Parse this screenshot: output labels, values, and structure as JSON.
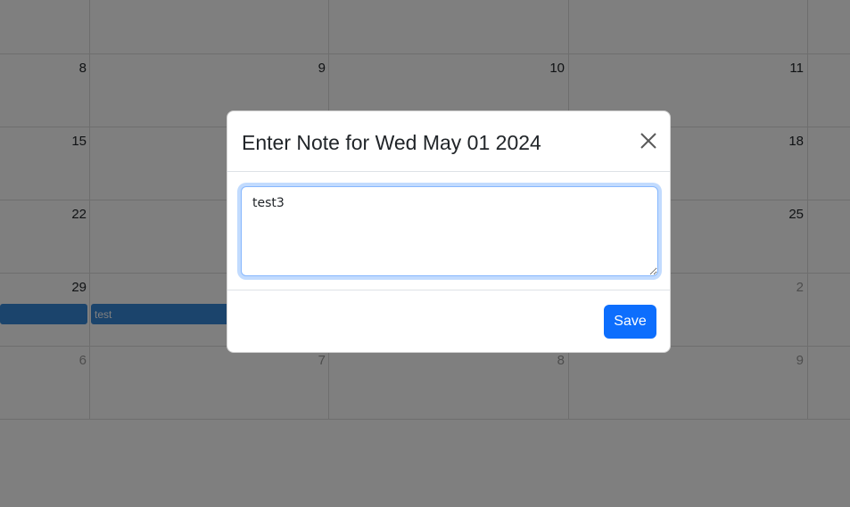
{
  "calendar": {
    "rows": [
      [
        "",
        "",
        "",
        ""
      ],
      [
        "8",
        "9",
        "10",
        "11"
      ],
      [
        "15",
        "",
        "",
        "18"
      ],
      [
        "22",
        "",
        "",
        "25"
      ],
      [
        "29",
        "",
        "",
        "2"
      ],
      [
        "6",
        "7",
        "8",
        "9"
      ]
    ],
    "events": [
      {
        "label": ""
      },
      {
        "label": "test"
      }
    ]
  },
  "modal": {
    "title": "Enter Note for Wed May 01 2024",
    "note_value": "test3",
    "save_label": "Save",
    "close_icon": "close-icon"
  },
  "colors": {
    "primary": "#0d6efd",
    "event": "#3788d8",
    "overlay": "rgba(0,0,0,0.5)"
  }
}
